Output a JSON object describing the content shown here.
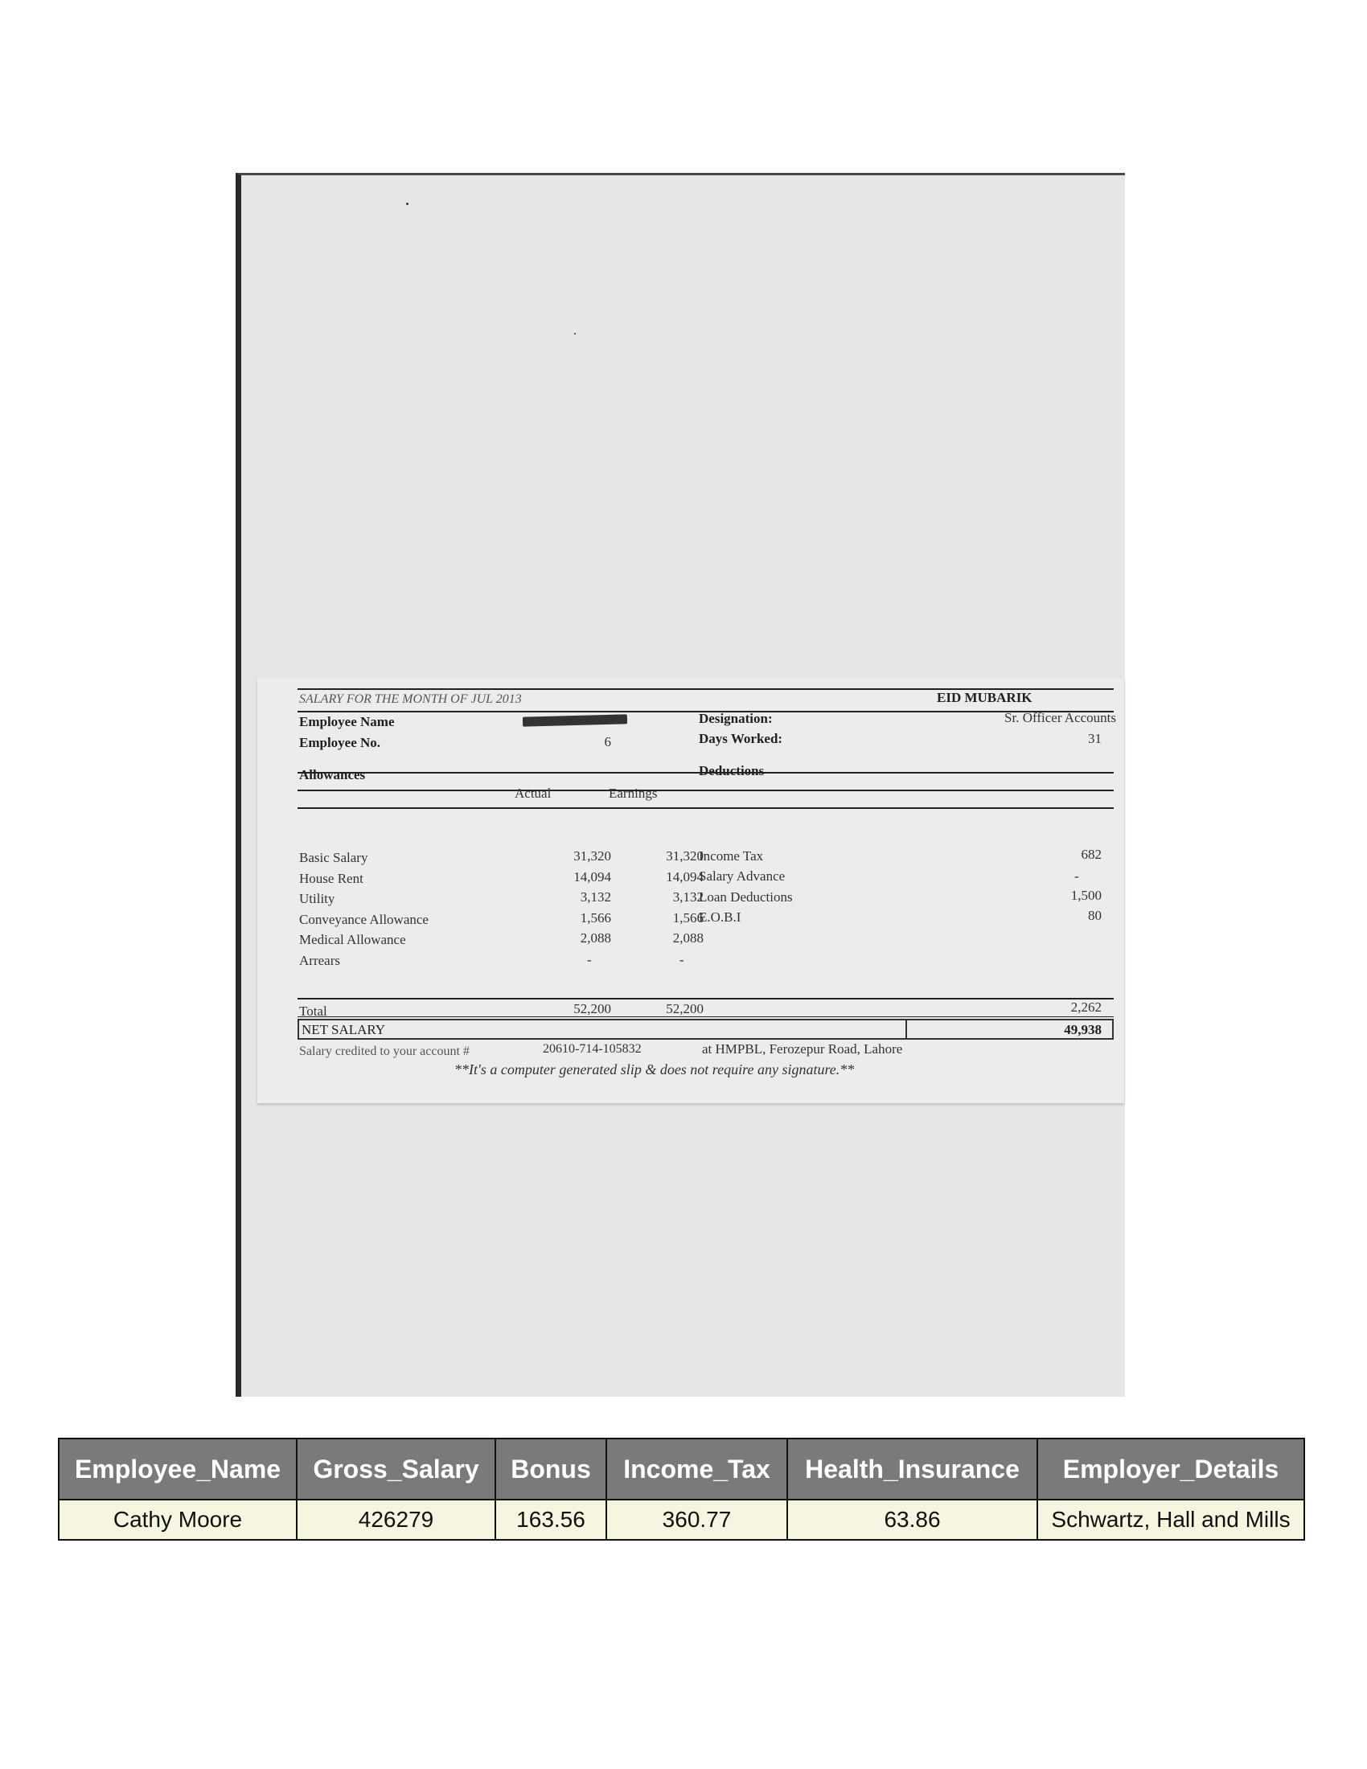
{
  "slip": {
    "header_title": "SALARY FOR THE MONTH OF JUL 2013",
    "header_greeting": "EID MUBARIK",
    "employee_name_label": "Employee Name",
    "employee_no_label": "Employee No.",
    "employee_no_value": "6",
    "designation_label": "Designation:",
    "designation_value": "Sr. Officer Accounts",
    "days_worked_label": "Days Worked:",
    "days_worked_value": "31",
    "allowances_label": "Allowances",
    "deductions_label": "Deductions",
    "actual_label": "Actual",
    "earnings_label": "Earnings",
    "allowances": [
      {
        "name": "Basic Salary",
        "actual": "31,320",
        "earnings": "31,320"
      },
      {
        "name": "House Rent",
        "actual": "14,094",
        "earnings": "14,094"
      },
      {
        "name": "Utility",
        "actual": "3,132",
        "earnings": "3,132"
      },
      {
        "name": "Conveyance Allowance",
        "actual": "1,566",
        "earnings": "1,566"
      },
      {
        "name": "Medical Allowance",
        "actual": "2,088",
        "earnings": "2,088"
      },
      {
        "name": "Arrears",
        "actual": "-",
        "earnings": "-"
      }
    ],
    "deductions": [
      {
        "name": "Income Tax",
        "amount": "682"
      },
      {
        "name": "Salary Advance",
        "amount": "-"
      },
      {
        "name": "Loan Deductions",
        "amount": "1,500"
      },
      {
        "name": "E.O.B.I",
        "amount": "80"
      }
    ],
    "total_label": "Total",
    "total_actual": "52,200",
    "total_earnings": "52,200",
    "total_deductions": "2,262",
    "net_salary_label": "NET SALARY",
    "net_salary_value": "49,938",
    "credit_text": "Salary credited to your account #",
    "account_number": "20610-714-105832",
    "bank_text": "at HMPBL, Ferozepur Road, Lahore",
    "footer_note": "**It's a computer generated slip & does not require any signature.**"
  },
  "table": {
    "headers": [
      "Employee_Name",
      "Gross_Salary",
      "Bonus",
      "Income_Tax",
      "Health_Insurance",
      "Employer_Details"
    ],
    "rows": [
      [
        "Cathy Moore",
        "426279",
        "163.56",
        "360.77",
        "63.86",
        "Schwartz, Hall and Mills"
      ]
    ]
  }
}
